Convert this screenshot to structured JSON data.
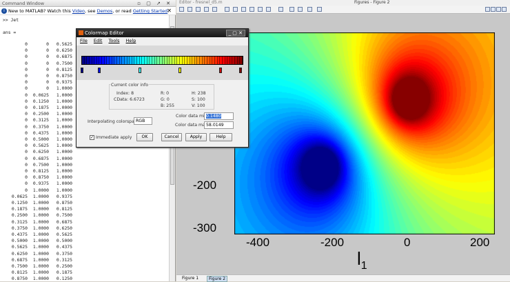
{
  "command_window": {
    "title": "Command Window",
    "info_prefix": "New to MATLAB? Watch this ",
    "link_video": "Video",
    "info_mid1": ", see ",
    "link_demos": "Demos",
    "info_mid2": ", or read ",
    "link_getting_started": "Getting Started",
    "info_end": ".",
    "prompt_line": ">> Jet",
    "ans_line": "ans =",
    "rows": [
      [
        "0",
        "0",
        "0.5625"
      ],
      [
        "0",
        "0",
        "0.6250"
      ],
      [
        "0",
        "0",
        "0.6875"
      ],
      [
        "0",
        "0",
        "0.7500"
      ],
      [
        "0",
        "0",
        "0.8125"
      ],
      [
        "0",
        "0",
        "0.8750"
      ],
      [
        "0",
        "0",
        "0.9375"
      ],
      [
        "0",
        "0",
        "1.0000"
      ],
      [
        "0",
        "0.0625",
        "1.0000"
      ],
      [
        "0",
        "0.1250",
        "1.0000"
      ],
      [
        "0",
        "0.1875",
        "1.0000"
      ],
      [
        "0",
        "0.2500",
        "1.0000"
      ],
      [
        "0",
        "0.3125",
        "1.0000"
      ],
      [
        "0",
        "0.3750",
        "1.0000"
      ],
      [
        "0",
        "0.4375",
        "1.0000"
      ],
      [
        "0",
        "0.5000",
        "1.0000"
      ],
      [
        "0",
        "0.5625",
        "1.0000"
      ],
      [
        "0",
        "0.6250",
        "1.0000"
      ],
      [
        "0",
        "0.6875",
        "1.0000"
      ],
      [
        "0",
        "0.7500",
        "1.0000"
      ],
      [
        "0",
        "0.8125",
        "1.0000"
      ],
      [
        "0",
        "0.8750",
        "1.0000"
      ],
      [
        "0",
        "0.9375",
        "1.0000"
      ],
      [
        "0",
        "1.0000",
        "1.0000"
      ],
      [
        "0.0625",
        "1.0000",
        "0.9375"
      ],
      [
        "0.1250",
        "1.0000",
        "0.8750"
      ],
      [
        "0.1875",
        "1.0000",
        "0.8125"
      ],
      [
        "0.2500",
        "1.0000",
        "0.7500"
      ],
      [
        "0.3125",
        "1.0000",
        "0.6875"
      ],
      [
        "0.3750",
        "1.0000",
        "0.6250"
      ],
      [
        "0.4375",
        "1.0000",
        "0.5625"
      ],
      [
        "0.5000",
        "1.0000",
        "0.5000"
      ],
      [
        "0.5625",
        "1.0000",
        "0.4375"
      ],
      [
        "0.6250",
        "1.0000",
        "0.3750"
      ],
      [
        "0.6875",
        "1.0000",
        "0.3125"
      ],
      [
        "0.7500",
        "1.0000",
        "0.2500"
      ],
      [
        "0.8125",
        "1.0000",
        "0.1875"
      ],
      [
        "0.8750",
        "1.0000",
        "0.1250"
      ]
    ]
  },
  "editor_tab": "Editor - fresnel_d5.m",
  "figure_window": {
    "title": "Figures - Figure 2",
    "tabs": [
      "Figure 1",
      "Figure 2"
    ],
    "x_ticks": [
      "-400",
      "-200",
      "0",
      "200"
    ],
    "y_ticks": [
      "-200",
      "-300"
    ],
    "xlabel": "l",
    "xlabel_sub": "1"
  },
  "colormap_editor": {
    "title": "Colormap Editor",
    "menu": [
      "File",
      "Edit",
      "Tools",
      "Help"
    ],
    "current_color_info_label": "Current color info",
    "index": "Index: 8",
    "cdata": "CData: 6.6723",
    "r": "R: 0",
    "g": "G: 0",
    "b": "B: 255",
    "h": "H: 238",
    "s": "S: 100",
    "v": "V: 100",
    "interp_label": "Interpolating colorspace:",
    "interp_value": "RGB",
    "cmin_label": "Color data min:",
    "cmin_value": "0.1480",
    "cmax_label": "Color data max:",
    "cmax_value": "58.0149",
    "immediate_apply": "Immediate apply",
    "immediate_apply_checked": true,
    "ok": "OK",
    "cancel": "Cancel",
    "apply": "Apply",
    "help": "Help",
    "marker_colors": [
      "#00008f",
      "#0010ff",
      "#40ffff",
      "#ffff00",
      "#d00000",
      "#800000"
    ]
  }
}
